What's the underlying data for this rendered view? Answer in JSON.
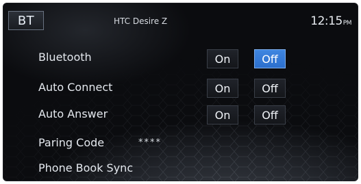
{
  "header": {
    "mode_label": "BT",
    "device_name": "HTC Desire Z",
    "time": "12:15",
    "ampm": "PM"
  },
  "settings": [
    {
      "label": "Bluetooth",
      "on_label": "On",
      "off_label": "Off",
      "selected": "Off"
    },
    {
      "label": "Auto Connect",
      "on_label": "On",
      "off_label": "Off",
      "selected": "none"
    },
    {
      "label": "Auto Answer",
      "on_label": "On",
      "off_label": "Off",
      "selected": "none"
    }
  ],
  "pairing_code": {
    "label": "Paring Code",
    "value": "****"
  },
  "phone_book_sync": {
    "label": "Phone Book Sync"
  },
  "colors": {
    "accent": "#3a7ddb",
    "background": "#0b0c0f",
    "text": "#e4e8ee"
  }
}
